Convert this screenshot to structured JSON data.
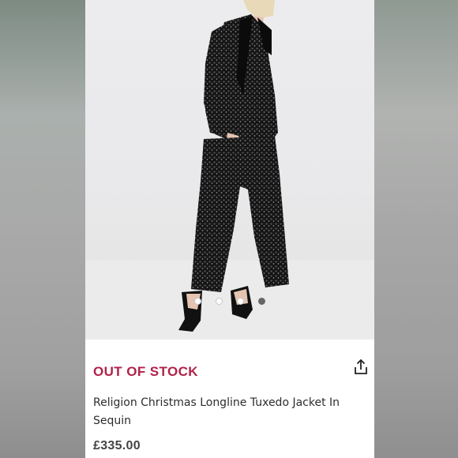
{
  "product_image": {
    "alt": "Model wearing black sequin tuxedo jacket and matching trousers",
    "carousel": {
      "count": 4,
      "active_index": 3
    }
  },
  "product": {
    "stock_status": "OUT OF STOCK",
    "title": "Religion Christmas Longline Tuxedo Jacket In Sequin",
    "price": "£335.00"
  },
  "icons": {
    "share": "share-icon"
  },
  "colors": {
    "status": "#b0224b",
    "text": "#2d2d2d"
  }
}
